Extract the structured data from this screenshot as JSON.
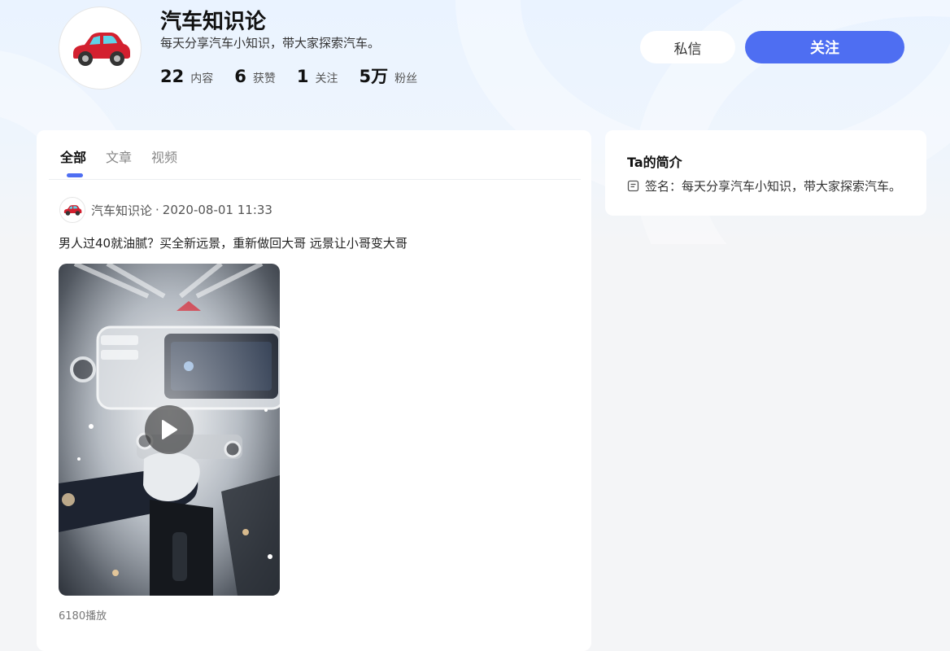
{
  "profile": {
    "name": "汽车知识论",
    "description": "每天分享汽车小知识，带大家探索汽车。",
    "avatar_icon": "red-car-icon"
  },
  "stats": [
    {
      "num": "22",
      "label": "内容"
    },
    {
      "num": "6",
      "label": "获赞"
    },
    {
      "num": "1",
      "label": "关注"
    },
    {
      "num": "5万",
      "label": "粉丝"
    }
  ],
  "actions": {
    "message_label": "私信",
    "follow_label": "关注"
  },
  "tabs": [
    {
      "label": "全部"
    },
    {
      "label": "文章"
    },
    {
      "label": "视频"
    }
  ],
  "post": {
    "author": "汽车知识论",
    "separator": "·",
    "time": "2020-08-01 11:33",
    "title": "男人过40就油腻？买全新远景，重新做回大哥 远景让小哥变大哥",
    "play_count": "6180播放",
    "play_icon": "play-icon"
  },
  "sidebar": {
    "title": "Ta的简介",
    "signature": "签名：每天分享汽车小知识，带大家探索汽车。",
    "signature_icon": "document-icon"
  },
  "colors": {
    "accent": "#4e6ef2",
    "car_red": "#d3202f"
  }
}
